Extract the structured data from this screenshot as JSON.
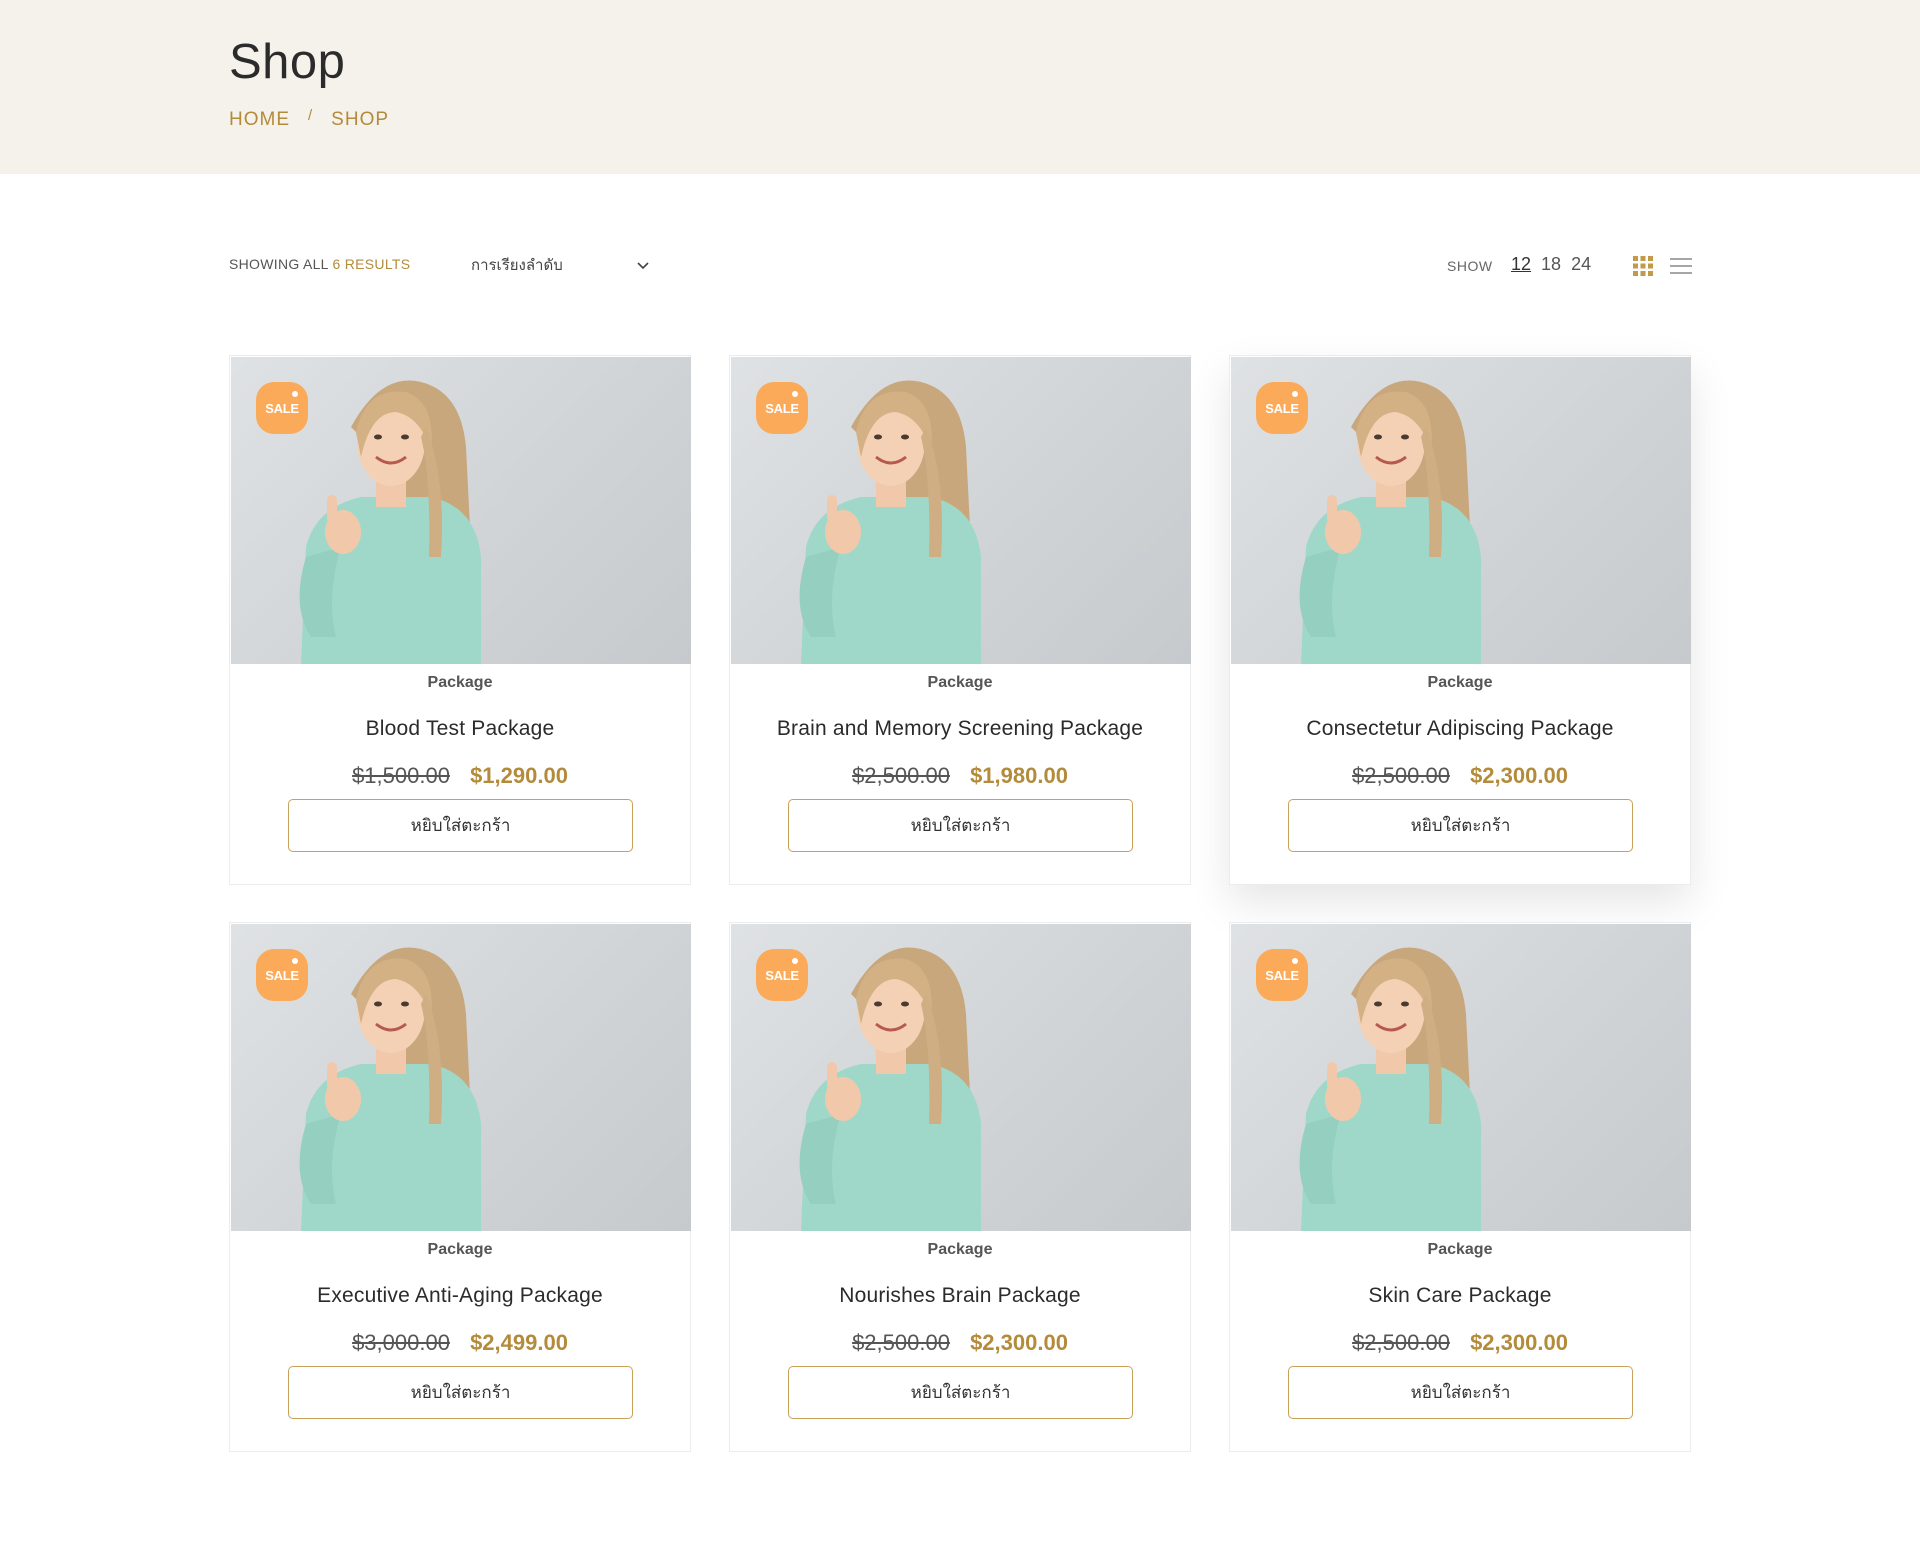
{
  "header": {
    "title": "Shop",
    "breadcrumb": {
      "home": "HOME",
      "sep": "/",
      "current": "SHOP"
    }
  },
  "toolbar": {
    "results_prefix": "SHOWING ALL",
    "results_count": "6 RESULTS",
    "sort_value": "การเรียงลำดับ",
    "show_label": "SHOW",
    "show_options": [
      "12",
      "18",
      "24"
    ],
    "show_active": "12"
  },
  "colors": {
    "accent": "#b38b3a",
    "badge": "#fbaa5a",
    "header_bg": "#f5f2ec"
  },
  "products": [
    {
      "badge": "SALE",
      "category": "Package",
      "name": "Blood Test Package",
      "old_price": "$1,500.00",
      "new_price": "$1,290.00",
      "button": "หยิบใส่ตะกร้า"
    },
    {
      "badge": "SALE",
      "category": "Package",
      "name": "Brain and Memory Screening Package",
      "old_price": "$2,500.00",
      "new_price": "$1,980.00",
      "button": "หยิบใส่ตะกร้า"
    },
    {
      "badge": "SALE",
      "category": "Package",
      "name": "Consectetur Adipiscing Package",
      "old_price": "$2,500.00",
      "new_price": "$2,300.00",
      "button": "หยิบใส่ตะกร้า"
    },
    {
      "badge": "SALE",
      "category": "Package",
      "name": "Executive Anti-Aging Package",
      "old_price": "$3,000.00",
      "new_price": "$2,499.00",
      "button": "หยิบใส่ตะกร้า"
    },
    {
      "badge": "SALE",
      "category": "Package",
      "name": "Nourishes Brain Package",
      "old_price": "$2,500.00",
      "new_price": "$2,300.00",
      "button": "หยิบใส่ตะกร้า"
    },
    {
      "badge": "SALE",
      "category": "Package",
      "name": "Skin Care Package",
      "old_price": "$2,500.00",
      "new_price": "$2,300.00",
      "button": "หยิบใส่ตะกร้า"
    }
  ]
}
